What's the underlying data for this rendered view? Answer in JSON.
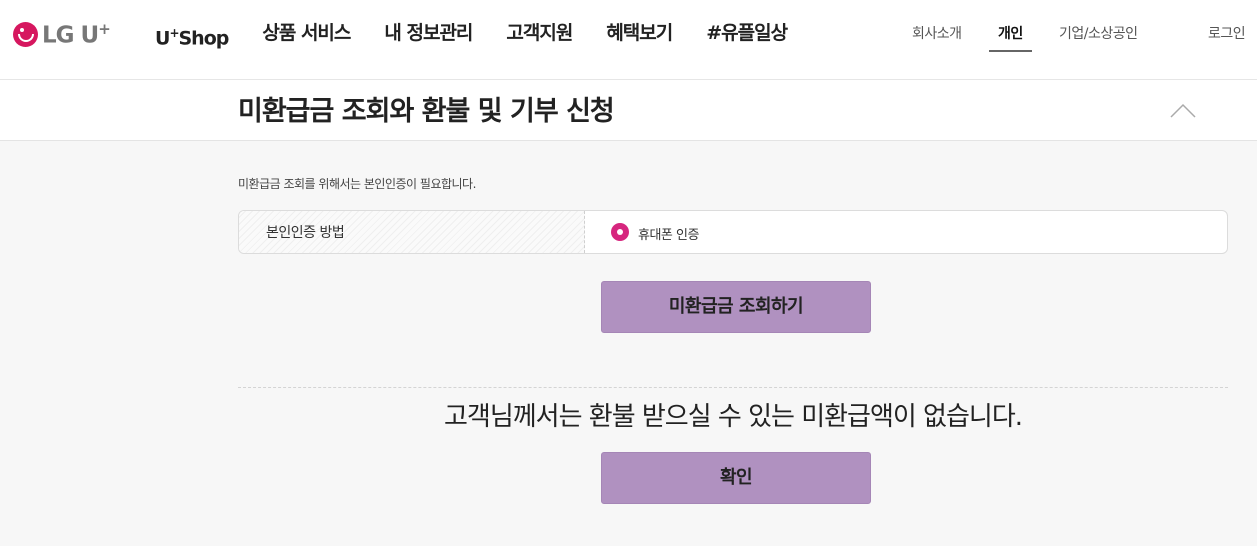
{
  "header": {
    "logo": {
      "text": "LG U",
      "sup": "+"
    },
    "gnb": [
      {
        "label": "U",
        "sup": "+",
        "rest": "Shop"
      },
      {
        "label": "상품 서비스"
      },
      {
        "label": "내 정보관리"
      },
      {
        "label": "고객지원"
      },
      {
        "label": "혜택보기"
      },
      {
        "label": "#유플일상"
      }
    ],
    "util": {
      "company": "회사소개",
      "personal": "개인",
      "business": "기업/소상공인",
      "login": "로그인"
    }
  },
  "title_bar": {
    "title": "미환급금 조회와 환불 및 기부 신청",
    "collapse_icon": "chevron-up-icon"
  },
  "form": {
    "note": "미환급금 조회를 위해서는 본인인증이 필요합니다.",
    "auth_label": "본인인증 방법",
    "auth_option": "휴대폰 인증",
    "query_button": "미환급금 조회하기"
  },
  "result": {
    "message": "고객님께서는 환불 받으실 수 있는 미환급액이 없습니다.",
    "ok_button": "확인"
  },
  "colors": {
    "brand": "#d6175f",
    "button": "#b091c0",
    "radio": "#d6267e"
  }
}
